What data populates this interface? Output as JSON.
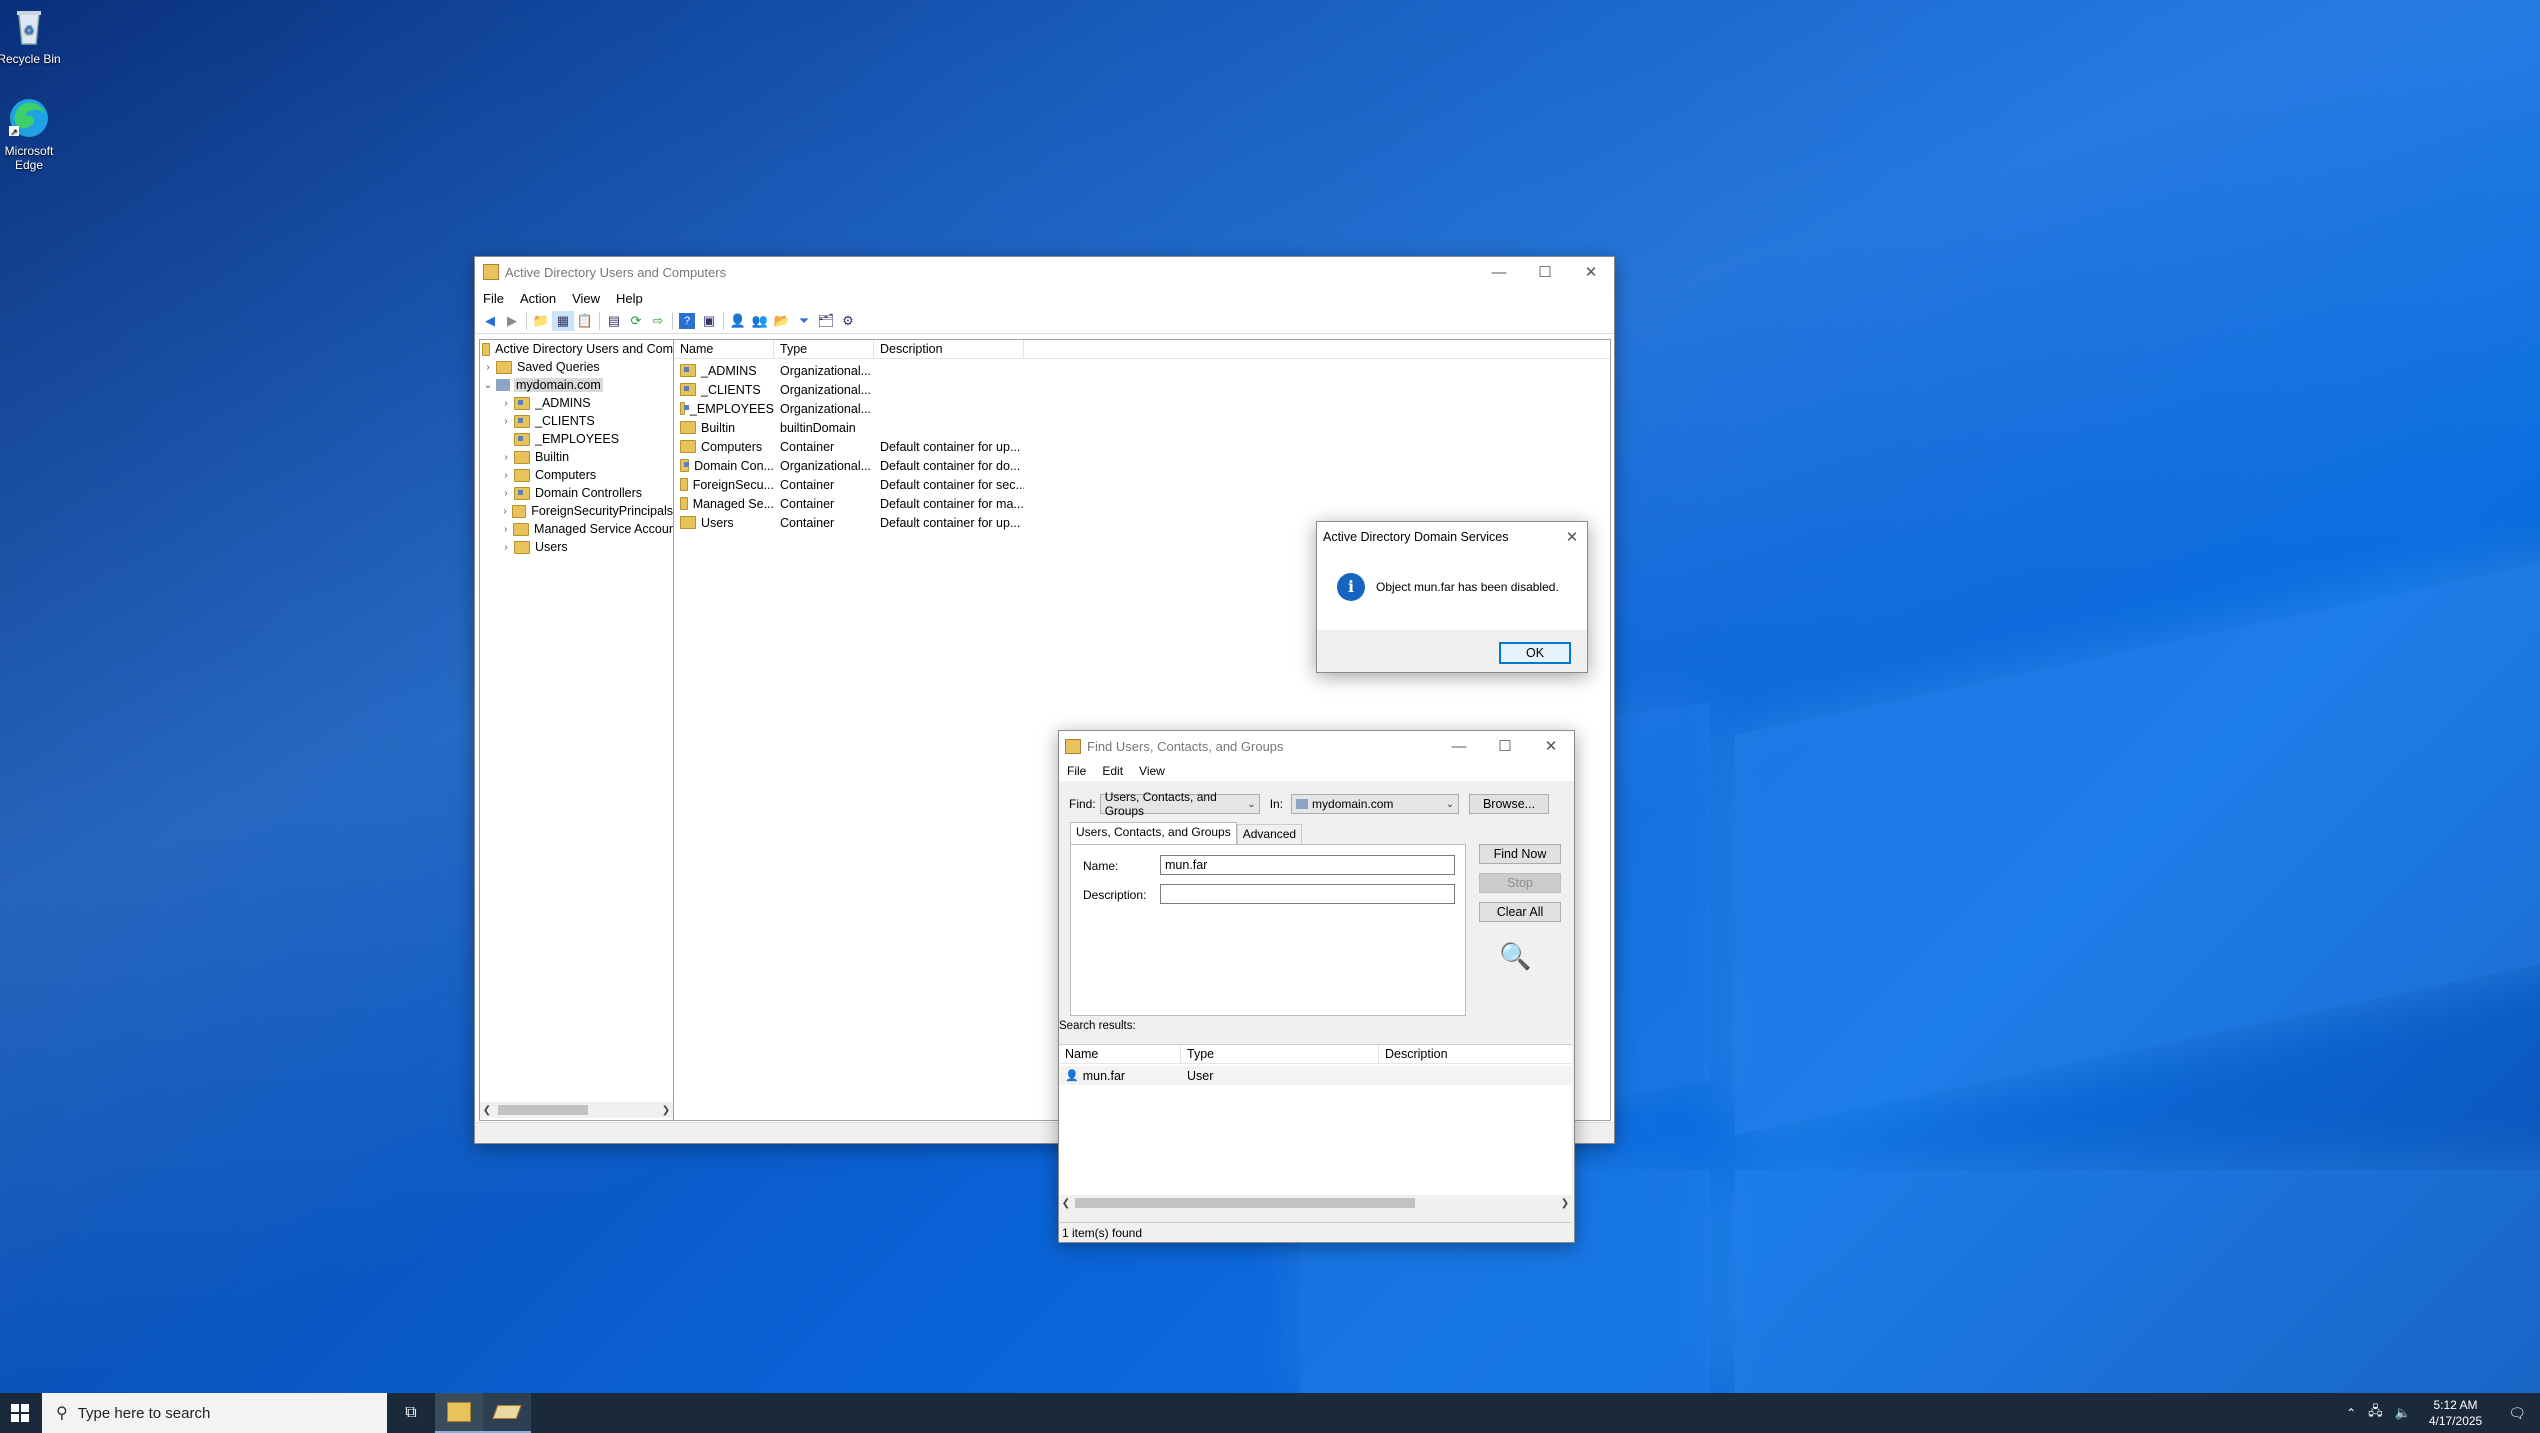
{
  "desktop": {
    "icons": [
      {
        "label": "Recycle Bin",
        "icon": "recycle-bin-icon"
      },
      {
        "label": "Microsoft Edge",
        "icon": "edge-icon"
      }
    ]
  },
  "aduc": {
    "title": "Active Directory Users and Computers",
    "menu": [
      "File",
      "Action",
      "View",
      "Help"
    ],
    "tree": {
      "root": "Active Directory Users and Com",
      "saved_queries": "Saved Queries",
      "domain": "mydomain.com",
      "children": [
        "_ADMINS",
        "_CLIENTS",
        "_EMPLOYEES",
        "Builtin",
        "Computers",
        "Domain Controllers",
        "ForeignSecurityPrincipals",
        "Managed Service Accour",
        "Users"
      ]
    },
    "columns": [
      "Name",
      "Type",
      "Description"
    ],
    "rows": [
      {
        "name": "_ADMINS",
        "type": "Organizational...",
        "desc": ""
      },
      {
        "name": "_CLIENTS",
        "type": "Organizational...",
        "desc": ""
      },
      {
        "name": "_EMPLOYEES",
        "type": "Organizational...",
        "desc": ""
      },
      {
        "name": "Builtin",
        "type": "builtinDomain",
        "desc": ""
      },
      {
        "name": "Computers",
        "type": "Container",
        "desc": "Default container for up..."
      },
      {
        "name": "Domain Con...",
        "type": "Organizational...",
        "desc": "Default container for do..."
      },
      {
        "name": "ForeignSecu...",
        "type": "Container",
        "desc": "Default container for sec..."
      },
      {
        "name": "Managed Se...",
        "type": "Container",
        "desc": "Default container for ma..."
      },
      {
        "name": "Users",
        "type": "Container",
        "desc": "Default container for up..."
      }
    ]
  },
  "msgbox": {
    "title": "Active Directory Domain Services",
    "message": "Object mun.far has been disabled.",
    "ok": "OK"
  },
  "find": {
    "title": "Find Users, Contacts, and Groups",
    "menu": [
      "File",
      "Edit",
      "View"
    ],
    "find_label": "Find:",
    "find_value": "Users, Contacts, and Groups",
    "in_label": "In:",
    "in_value": "mydomain.com",
    "browse": "Browse...",
    "tabs": [
      "Users, Contacts, and Groups",
      "Advanced"
    ],
    "name_label": "Name:",
    "name_value": "mun.far",
    "desc_label": "Description:",
    "desc_value": "",
    "find_now": "Find Now",
    "stop": "Stop",
    "clear_all": "Clear All",
    "results_label": "Search results:",
    "result_columns": [
      "Name",
      "Type",
      "Description"
    ],
    "results": [
      {
        "name": "mun.far",
        "type": "User",
        "desc": ""
      }
    ],
    "status": "1 item(s) found"
  },
  "taskbar": {
    "search_placeholder": "Type here to search",
    "time": "5:12 AM",
    "date": "4/17/2025"
  }
}
